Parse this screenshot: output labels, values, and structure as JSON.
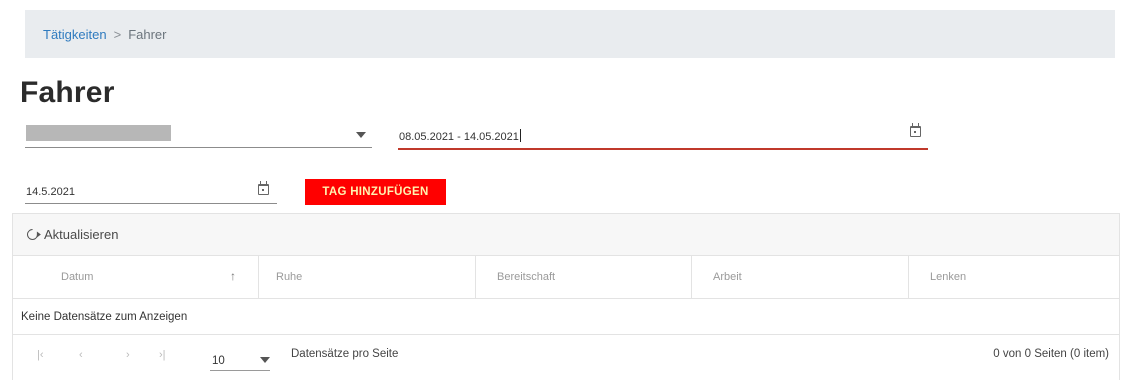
{
  "breadcrumb": {
    "parent": "Tätigkeiten",
    "separator": ">",
    "current": "Fahrer"
  },
  "page": {
    "title": "Fahrer"
  },
  "filters": {
    "driver_select": {
      "value": ""
    },
    "date_range": {
      "value": "08.05.2021 - 14.05.2021"
    },
    "single_date": {
      "value": "14.5.2021"
    },
    "add_day_button": "TAG HINZUFÜGEN"
  },
  "grid": {
    "toolbar": {
      "refresh_label": "Aktualisieren"
    },
    "columns": [
      "Datum",
      "Ruhe",
      "Bereitschaft",
      "Arbeit",
      "Lenken"
    ],
    "sort_indicator": "↑",
    "empty_message": "Keine Datensätze zum Anzeigen",
    "pager": {
      "first": "|‹",
      "prev": "‹",
      "next": "›",
      "last": "›|",
      "page_size": "10",
      "per_page_label": "Datensätze pro Seite",
      "info": "0 von 0 Seiten (0 item)"
    }
  },
  "colors": {
    "accent_red": "#ff0000",
    "link_blue": "#2f7bbf",
    "breadcrumb_bg": "#e9ecef"
  }
}
